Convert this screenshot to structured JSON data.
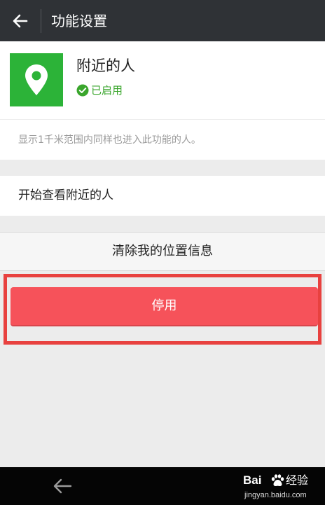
{
  "header": {
    "title": "功能设置",
    "back_icon": "arrow-left-icon"
  },
  "feature": {
    "name": "附近的人",
    "status": "已启用",
    "icon": "location-pin-icon",
    "icon_bg": "#2cb338",
    "status_color": "#3aa62c"
  },
  "description": "显示1千米范围内同样也进入此功能的人。",
  "actions": {
    "view_nearby": "开始查看附近的人",
    "clear_location": "清除我的位置信息",
    "disable": "停用"
  },
  "colors": {
    "header_bg": "#2f3236",
    "page_bg": "#ececec",
    "disable_button": "#f6525a",
    "highlight_frame": "#e8413f"
  },
  "nav_bar": {
    "back_icon": "nav-back-arrow-icon"
  },
  "watermark": {
    "logo": "Bai",
    "name": "经验",
    "url": "jingyan.baidu.com"
  }
}
